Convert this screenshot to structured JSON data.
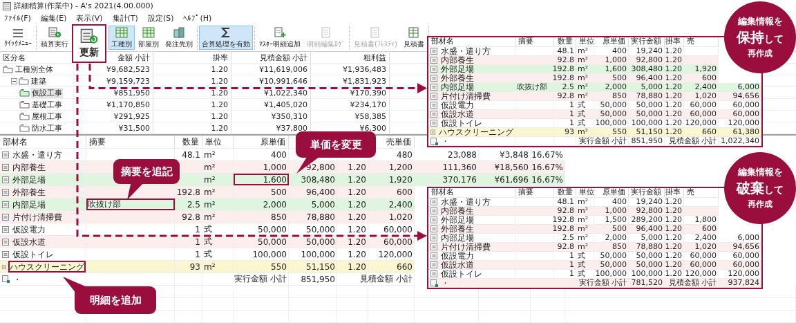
{
  "window": {
    "title": "詳細積算(作業中) - A's 2021(4.00.000)"
  },
  "menu": [
    "ﾌｧｲﾙ(F)",
    "編集(E)",
    "表示(V)",
    "集計(T)",
    "設定(S)",
    "ﾍﾙﾌﾟ(H)"
  ],
  "toolbar": {
    "groups": [
      [
        {
          "label": "ｸｲｯｸﾒﾆｭｰ",
          "kind": "menu",
          "selected": false,
          "disabled": false
        }
      ],
      [
        {
          "label": "積算実行",
          "kind": "run",
          "selected": false,
          "disabled": false
        },
        {
          "label": "更新",
          "kind": "callout",
          "selected": false,
          "disabled": false
        },
        {
          "label": "工種別",
          "kind": "grid",
          "selected": true,
          "disabled": false
        },
        {
          "label": "部屋別",
          "kind": "grid",
          "selected": false,
          "disabled": false
        },
        {
          "label": "発注先別",
          "kind": "building",
          "selected": false,
          "disabled": false
        }
      ],
      [
        {
          "label": "合算処理を有効",
          "kind": "sum",
          "selected": true,
          "disabled": false
        }
      ],
      [
        {
          "label": "ﾏｽﾀｰ明細追加",
          "kind": "add",
          "selected": false,
          "disabled": false
        },
        {
          "label": "明細編集ﾛｸﾞ",
          "kind": "doc",
          "selected": false,
          "disabled": true
        }
      ],
      [
        {
          "label": "見積書(ﾌﾚｽﾃｨ)",
          "kind": "doc",
          "selected": false,
          "disabled": true
        },
        {
          "label": "見積書",
          "kind": "sheet",
          "selected": false,
          "disabled": false
        }
      ]
    ]
  },
  "summary_table": {
    "columns": [
      "区分名",
      "金額 小計",
      "掛率",
      "見積金額 小計",
      "粗利益"
    ],
    "rows": [
      {
        "name": "工種別全体",
        "values": [
          "¥9,682,523",
          "1.20",
          "¥11,619,006",
          "¥1,936,483"
        ],
        "selected": false,
        "children": [
          {
            "name": "建築",
            "values": [
              "¥9,159,723",
              "1.20",
              "¥10,991,646",
              "¥1,831,923"
            ],
            "selected": false,
            "expanded": true,
            "children": [
              {
                "name": "仮設工事",
                "values": [
                  "¥851,950",
                  "1.20",
                  "¥1,022,340",
                  "¥170,390"
                ],
                "selected": true
              },
              {
                "name": "基礎工事",
                "values": [
                  "¥1,170,850",
                  "1.20",
                  "¥1,405,020",
                  "¥234,170"
                ],
                "selected": false
              },
              {
                "name": "屋根工事",
                "values": [
                  "¥291,925",
                  "1.20",
                  "¥350,310",
                  "¥58,385"
                ],
                "selected": false
              },
              {
                "name": "防水工事",
                "values": [
                  "¥31,500",
                  "1.20",
                  "¥37,800",
                  "¥6,300"
                ],
                "selected": false
              }
            ]
          }
        ]
      }
    ]
  },
  "detail_table": {
    "columns": [
      "部材名",
      "摘要",
      "数量",
      "単位",
      "原単価",
      null,
      null,
      "売単価"
    ],
    "rows": [
      {
        "edited": false,
        "added": false,
        "cells": [
          "水盛・遣り方",
          null,
          "48.1",
          "m²",
          "400",
          null,
          null,
          "480",
          "23,088",
          "¥3,848",
          "16.67%"
        ]
      },
      {
        "edited": false,
        "added": false,
        "cells": [
          "内部養生",
          null,
          null,
          "m²",
          "1,000",
          "92,800",
          "1.20",
          "1,200",
          "111,360",
          "¥18,560",
          "16.67%"
        ]
      },
      {
        "edited": true,
        "added": false,
        "cells": [
          "外部足場",
          null,
          null,
          "m²",
          {
            "text": "1,600",
            "outlined": true
          },
          "308,480",
          "1.20",
          "1,920",
          "370,176",
          "¥61,696",
          "16.67%"
        ]
      },
      {
        "edited": false,
        "added": false,
        "cells": [
          "外部養生",
          null,
          "192.8",
          "m²",
          "500",
          "96,400",
          "1.20",
          "600"
        ]
      },
      {
        "edited": true,
        "added": false,
        "cells": [
          "内部足場",
          {
            "text": "吹抜け部",
            "outlined": true
          },
          "2.5",
          "m²",
          "2,000",
          "5,000",
          "1.20",
          "2,400"
        ]
      },
      {
        "edited": false,
        "added": false,
        "cells": [
          "片付け清掃費",
          null,
          "92.8",
          "m²",
          "850",
          "78,880",
          "1.20",
          "1,020"
        ]
      },
      {
        "edited": false,
        "added": false,
        "cells": [
          "仮設電力",
          null,
          "1",
          "式",
          "50,000",
          "50,000",
          "1.20",
          "60,000"
        ]
      },
      {
        "edited": false,
        "added": false,
        "cells": [
          "仮設水道",
          null,
          "1",
          "式",
          "50,000",
          "50,000",
          "1.20",
          "60,000"
        ]
      },
      {
        "edited": false,
        "added": false,
        "cells": [
          "仮設トイレ",
          null,
          "1",
          "式",
          "100,000",
          "100,000",
          "1.20",
          "120,000"
        ]
      },
      {
        "edited": false,
        "added": true,
        "cells": [
          {
            "text": "ハウスクリーニング",
            "outlined": true
          },
          null,
          "93",
          "m²",
          "550",
          "51,150",
          "1.20",
          "660"
        ]
      }
    ],
    "total": {
      "mark": "・",
      "exec_label": "実行金額 小計",
      "exec_total": "851,950",
      "est_label": "見積金額 小計"
    }
  },
  "keep_preview": {
    "columns": [
      "部材名",
      "摘要",
      "数量",
      "単位",
      "原単価",
      "実行金額",
      "掛率",
      "売"
    ],
    "rows": [
      {
        "edited": false,
        "added": false,
        "cells": [
          "水盛・遣り方",
          null,
          "48.1",
          "m²",
          "400",
          "19,240",
          "1.20"
        ]
      },
      {
        "edited": false,
        "added": false,
        "cells": [
          "内部養生",
          null,
          "92.8",
          "m²",
          "1,000",
          "92,800",
          "1.20"
        ]
      },
      {
        "edited": true,
        "added": false,
        "cells": [
          "外部足場",
          null,
          "192.8",
          "m²",
          "1,600",
          "308,480",
          "1.20",
          "1,920"
        ]
      },
      {
        "edited": false,
        "added": false,
        "cells": [
          "外部養生",
          null,
          "192.8",
          "m²",
          "500",
          "96,400",
          "1.20",
          "600"
        ]
      },
      {
        "edited": true,
        "added": false,
        "cells": [
          "内部足場",
          "吹抜け部",
          "2.5",
          "m²",
          "2,000",
          "5,000",
          "1.20",
          "2,400",
          "6,000"
        ]
      },
      {
        "edited": false,
        "added": false,
        "cells": [
          "片付け清掃費",
          null,
          "92.8",
          "m²",
          "850",
          "78,880",
          "1.20",
          "1,020",
          "94,656"
        ]
      },
      {
        "edited": false,
        "added": false,
        "cells": [
          "仮設電力",
          null,
          "1",
          "式",
          "50,000",
          "50,000",
          "1.20",
          "60,000",
          "60,000"
        ]
      },
      {
        "edited": false,
        "added": false,
        "cells": [
          "仮設水道",
          null,
          "1",
          "式",
          "50,000",
          "50,000",
          "1.20",
          "60,000",
          "60,000"
        ]
      },
      {
        "edited": false,
        "added": false,
        "cells": [
          "仮設トイレ",
          null,
          "1",
          "式",
          "100,000",
          "100,000",
          "1.20",
          "120,000",
          "120,000"
        ]
      },
      {
        "edited": false,
        "added": true,
        "cells": [
          "ハウスクリーニング",
          null,
          "93",
          "m²",
          "550",
          "51,150",
          "1.20",
          "660",
          "61,380"
        ]
      }
    ],
    "total": {
      "mark": "・",
      "exec_label": "実行金額 小計",
      "exec_total": "851,950",
      "est_label": "見積金額 小計",
      "est_total": "1,022,340"
    },
    "badge": {
      "top": "編集情報を",
      "emphasis": "保持",
      "suffix": "して",
      "bottom": "再作成"
    }
  },
  "discard_preview": {
    "columns": [
      "部材名",
      "摘要",
      "数量",
      "単位",
      "原単価",
      "実行金額",
      "掛率",
      "売"
    ],
    "rows": [
      {
        "edited": false,
        "added": false,
        "cells": [
          "水盛・遣り方",
          null,
          "48.1",
          "m²",
          "400",
          "19,240",
          "1.20"
        ]
      },
      {
        "edited": false,
        "added": false,
        "cells": [
          "内部養生",
          null,
          "92.8",
          "m²",
          "1,000",
          "92,800",
          "1.20"
        ]
      },
      {
        "edited": false,
        "added": false,
        "cells": [
          "外部足場",
          null,
          "192.8",
          "m²",
          "1,500",
          "289,200",
          "1.20",
          "1,800"
        ]
      },
      {
        "edited": false,
        "added": false,
        "cells": [
          "外部養生",
          null,
          "192.8",
          "m²",
          "500",
          "96,400",
          "1.20",
          "600"
        ]
      },
      {
        "edited": false,
        "added": false,
        "cells": [
          "内部足場",
          null,
          "2.5",
          "m²",
          "2,000",
          "5,000",
          "1.20",
          "2,400",
          "6,000"
        ]
      },
      {
        "edited": false,
        "added": false,
        "cells": [
          "片付け清掃費",
          null,
          "92.8",
          "m²",
          "850",
          "78,880",
          "1.20",
          "1,020",
          "94,656"
        ]
      },
      {
        "edited": false,
        "added": false,
        "cells": [
          "仮設電力",
          null,
          "1",
          "式",
          "50,000",
          "50,000",
          "1.20",
          "60,000",
          "60,000"
        ]
      },
      {
        "edited": false,
        "added": false,
        "cells": [
          "仮設水道",
          null,
          "1",
          "式",
          "50,000",
          "50,000",
          "1.20",
          "60,000",
          "60,000"
        ]
      },
      {
        "edited": false,
        "added": false,
        "cells": [
          "仮設トイレ",
          null,
          "1",
          "式",
          "100,000",
          "100,000",
          "1.20",
          "120,000",
          "120,000"
        ]
      }
    ],
    "total": {
      "mark": "・",
      "exec_label": "実行金額 小計",
      "exec_total": "781,520",
      "est_label": "見積金額 小計",
      "est_total": "937,824"
    },
    "badge": {
      "top": "編集情報を",
      "emphasis": "破棄",
      "suffix": "して",
      "bottom": "再作成"
    }
  },
  "callouts": [
    "単価を変更",
    "摘要を追記",
    "明細を追加"
  ]
}
